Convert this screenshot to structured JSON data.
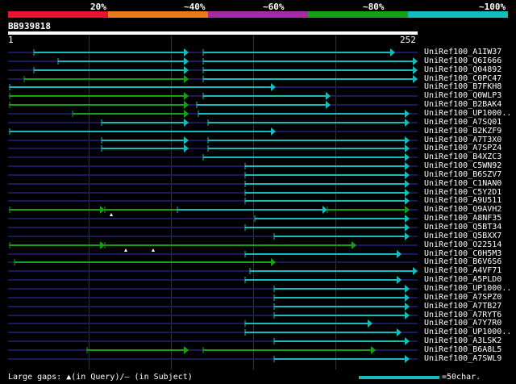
{
  "legend": {
    "labels": [
      "20%",
      "~40%",
      "~60%",
      "~80%",
      "~100%"
    ],
    "colors": [
      "#e8132c",
      "#e87c1c",
      "#a42ca4",
      "#16a016",
      "#16bcbc"
    ]
  },
  "query": {
    "id": "BB939818",
    "start": "1",
    "end": "252"
  },
  "hits": [
    {
      "label": "UniRef100_A1IW37",
      "segs": [
        [
          42,
          234,
          "#16bcbc",
          0,
          1
        ],
        [
          252,
          490,
          "#16bcbc",
          0,
          1
        ]
      ]
    },
    {
      "label": "UniRef100_Q6I666",
      "segs": [
        [
          72,
          234,
          "#16bcbc",
          0,
          1
        ],
        [
          252,
          518,
          "#16bcbc",
          0,
          1
        ]
      ]
    },
    {
      "label": "UniRef100_Q04892",
      "segs": [
        [
          42,
          234,
          "#16bcbc",
          0,
          1
        ],
        [
          252,
          518,
          "#16bcbc",
          0,
          1
        ]
      ]
    },
    {
      "label": "UniRef100_C0PC47",
      "segs": [
        [
          30,
          234,
          "#16a016",
          0,
          1
        ],
        [
          252,
          518,
          "#16bcbc",
          0,
          1
        ]
      ]
    },
    {
      "label": "UniRef100_B7FKH8",
      "segs": [
        [
          12,
          342,
          "#16bcbc",
          0,
          1
        ]
      ]
    },
    {
      "label": "UniRef100_Q0WLP3",
      "segs": [
        [
          12,
          234,
          "#16a016",
          0,
          1
        ],
        [
          252,
          410,
          "#16bcbc",
          0,
          1
        ]
      ]
    },
    {
      "label": "UniRef100_B2BAK4",
      "segs": [
        [
          12,
          234,
          "#16a016",
          0,
          1
        ],
        [
          244,
          410,
          "#16bcbc",
          0,
          1
        ]
      ]
    },
    {
      "label": "UniRef100_UP1000..",
      "segs": [
        [
          90,
          234,
          "#16a016",
          0,
          1
        ],
        [
          246,
          508,
          "#16bcbc",
          0,
          1
        ]
      ]
    },
    {
      "label": "UniRef100_A7SQ01",
      "segs": [
        [
          126,
          234,
          "#16bcbc",
          0,
          1
        ],
        [
          258,
          508,
          "#16bcbc",
          0,
          1
        ]
      ]
    },
    {
      "label": "UniRef100_B2KZF9",
      "segs": [
        [
          12,
          342,
          "#16bcbc",
          0,
          1
        ]
      ]
    },
    {
      "label": "UniRef100_A7T3X0",
      "segs": [
        [
          126,
          234,
          "#16bcbc",
          0,
          1
        ],
        [
          258,
          508,
          "#16bcbc",
          0,
          1
        ]
      ]
    },
    {
      "label": "UniRef100_A7SPZ4",
      "segs": [
        [
          126,
          234,
          "#16bcbc",
          0,
          1
        ],
        [
          258,
          508,
          "#16bcbc",
          0,
          1
        ]
      ]
    },
    {
      "label": "UniRef100_B4XZC3",
      "segs": [
        [
          252,
          508,
          "#16bcbc",
          0,
          1
        ]
      ]
    },
    {
      "label": "UniRef100_C5WN92",
      "segs": [
        [
          304,
          508,
          "#16bcbc",
          0,
          1
        ]
      ]
    },
    {
      "label": "UniRef100_B6SZV7",
      "segs": [
        [
          304,
          508,
          "#16bcbc",
          0,
          1
        ]
      ]
    },
    {
      "label": "UniRef100_C1NAN0",
      "segs": [
        [
          304,
          508,
          "#16bcbc",
          0,
          1
        ]
      ]
    },
    {
      "label": "UniRef100_C5Y2D1",
      "segs": [
        [
          304,
          508,
          "#16bcbc",
          0,
          1
        ]
      ]
    },
    {
      "label": "UniRef100_A9U511",
      "segs": [
        [
          304,
          508,
          "#16bcbc",
          0,
          1
        ]
      ]
    },
    {
      "label": "UniRef100_Q9AVH2",
      "segs": [
        [
          12,
          130,
          "#16a016",
          1,
          1
        ],
        [
          130,
          220,
          "#16a016",
          0,
          0
        ],
        [
          220,
          406,
          "#16bcbc",
          0,
          1
        ],
        [
          406,
          508,
          "#16a016",
          0,
          1
        ]
      ]
    },
    {
      "label": "UniRef100_A8NF35",
      "segs": [
        [
          316,
          508,
          "#16bcbc",
          0,
          1
        ]
      ]
    },
    {
      "label": "UniRef100_Q5BT34",
      "segs": [
        [
          304,
          508,
          "#16bcbc",
          0,
          1
        ]
      ]
    },
    {
      "label": "UniRef100_Q5BXX7",
      "segs": [
        [
          340,
          508,
          "#16bcbc",
          0,
          1
        ]
      ]
    },
    {
      "label": "UniRef100_O22514",
      "segs": [
        [
          12,
          130,
          "#16a016",
          1,
          1
        ],
        [
          130,
          442,
          "#16a016",
          0,
          1
        ]
      ]
    },
    {
      "label": "UniRef100_C0H5M3",
      "segs": [
        [
          304,
          498,
          "#16bcbc",
          0,
          1
        ]
      ]
    },
    {
      "label": "UniRef100_B6V6S6",
      "segs": [
        [
          18,
          342,
          "#16a016",
          0,
          1
        ]
      ]
    },
    {
      "label": "UniRef100_A4VF71",
      "segs": [
        [
          310,
          518,
          "#16bcbc",
          0,
          1
        ]
      ]
    },
    {
      "label": "UniRef100_A5PLD0",
      "segs": [
        [
          304,
          498,
          "#16bcbc",
          0,
          1
        ]
      ]
    },
    {
      "label": "UniRef100_UP1000..",
      "segs": [
        [
          340,
          508,
          "#16bcbc",
          0,
          1
        ]
      ]
    },
    {
      "label": "UniRef100_A7SPZ0",
      "segs": [
        [
          340,
          508,
          "#16bcbc",
          0,
          1
        ]
      ]
    },
    {
      "label": "UniRef100_A7TB27",
      "segs": [
        [
          340,
          508,
          "#16bcbc",
          0,
          1
        ]
      ]
    },
    {
      "label": "UniRef100_A7RYT6",
      "segs": [
        [
          340,
          508,
          "#16bcbc",
          0,
          1
        ]
      ]
    },
    {
      "label": "UniRef100_A7Y7R0",
      "segs": [
        [
          304,
          462,
          "#16bcbc",
          0,
          1
        ]
      ]
    },
    {
      "label": "UniRef100_UP1000..",
      "segs": [
        [
          304,
          498,
          "#16bcbc",
          0,
          1
        ]
      ]
    },
    {
      "label": "UniRef100_A3LSK2",
      "segs": [
        [
          340,
          508,
          "#16bcbc",
          0,
          1
        ]
      ]
    },
    {
      "label": "UniRef100_B6A8L5",
      "segs": [
        [
          108,
          234,
          "#16a016",
          0,
          1
        ],
        [
          252,
          466,
          "#16a016",
          0,
          1
        ]
      ]
    },
    {
      "label": "UniRef100_A7SWL9",
      "segs": [
        [
          340,
          508,
          "#16bcbc",
          0,
          1
        ]
      ]
    }
  ],
  "footer": {
    "text": "Large gaps: ▲(in Query)/– (in Subject)",
    "scale": "=50char."
  }
}
